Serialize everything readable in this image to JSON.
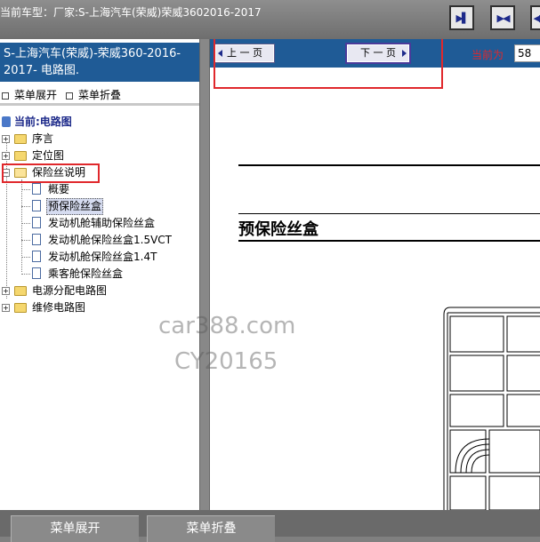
{
  "window": {
    "vehicle_title": "当前车型：厂家:S-上海汽车(荣威)荣威3602016-2017"
  },
  "toolbar": {
    "buttons": [
      {
        "name": "expand-right",
        "glyph": "▶▌"
      },
      {
        "name": "split-view",
        "glyph": "▶◀"
      },
      {
        "name": "collapse",
        "glyph": "◀▶"
      }
    ]
  },
  "sidebar": {
    "header": "S-上海汽车(荣威)-荣威360-2016-2017- 电路图.",
    "expand_label": "菜单展开",
    "collapse_label": "菜单折叠",
    "current_label": "当前:电路图",
    "tree": [
      {
        "label": "序言",
        "type": "folder",
        "expanded": false
      },
      {
        "label": "定位图",
        "type": "folder",
        "expanded": false
      },
      {
        "label": "保险丝说明",
        "type": "folder",
        "expanded": true,
        "children": [
          {
            "label": "概要"
          },
          {
            "label": "预保险丝盒",
            "selected": true
          },
          {
            "label": "发动机舱辅助保险丝盒"
          },
          {
            "label": "发动机舱保险丝盒1.5VCT"
          },
          {
            "label": "发动机舱保险丝盒1.4T"
          },
          {
            "label": "乘客舱保险丝盒"
          }
        ]
      },
      {
        "label": "电源分配电路图",
        "type": "folder",
        "expanded": false
      },
      {
        "label": "维修电路图",
        "type": "folder",
        "expanded": false
      }
    ]
  },
  "content": {
    "prev_label": "上 一 页",
    "next_label": "下 一 页",
    "page_label": "当前为",
    "page_value": "58",
    "doc_title": "预保险丝盒",
    "watermark_line1": "car388.com",
    "watermark_line2": "CY20165"
  },
  "bottom": {
    "expand_label": "菜单展开",
    "collapse_label": "菜单折叠"
  },
  "colors": {
    "header_blue": "#1f5b96",
    "highlight_red": "#e0282c",
    "link_blue": "#1d2a8a"
  }
}
